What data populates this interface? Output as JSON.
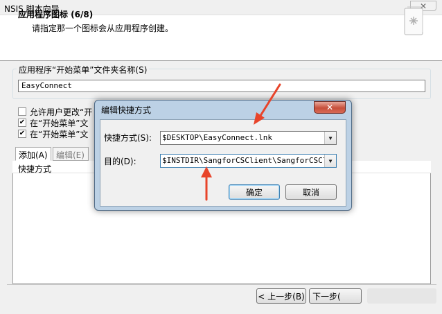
{
  "window": {
    "title": "NSIS 脚本向导",
    "close_glyph": "✕"
  },
  "header": {
    "title": "应用程序图标 (6/8)",
    "subtitle": "请指定那一个图标会从应用程序创建。"
  },
  "start_menu": {
    "group_label": "应用程序“开始菜单”文件夹名称(S)",
    "folder_value": "EasyConnect"
  },
  "options": [
    {
      "label": "允许用户更改“开",
      "checked": false
    },
    {
      "label": "在“开始菜单”文",
      "checked": true
    },
    {
      "label": "在“开始菜单”文",
      "checked": true
    }
  ],
  "tabs": {
    "add": "添加(A)",
    "edit": "编辑(E)"
  },
  "list": {
    "column": "快捷方式"
  },
  "nav": {
    "back": "< 上一步(B)",
    "next": "下一步("
  },
  "dialog": {
    "title": "编辑快捷方式",
    "close_glyph": "✕",
    "shortcut_label": "快捷方式(S):",
    "shortcut_value": "$DESKTOP\\EasyConnect.lnk",
    "target_label": "目的(D):",
    "target_value": "$INSTDIR\\SangforCSClient\\SangforCSClie",
    "ok": "确定",
    "cancel": "取消"
  },
  "colors": {
    "annotation_arrow": "#e8442a",
    "dialog_frame": "#bcd1e5",
    "close_red": "#c7503c"
  }
}
